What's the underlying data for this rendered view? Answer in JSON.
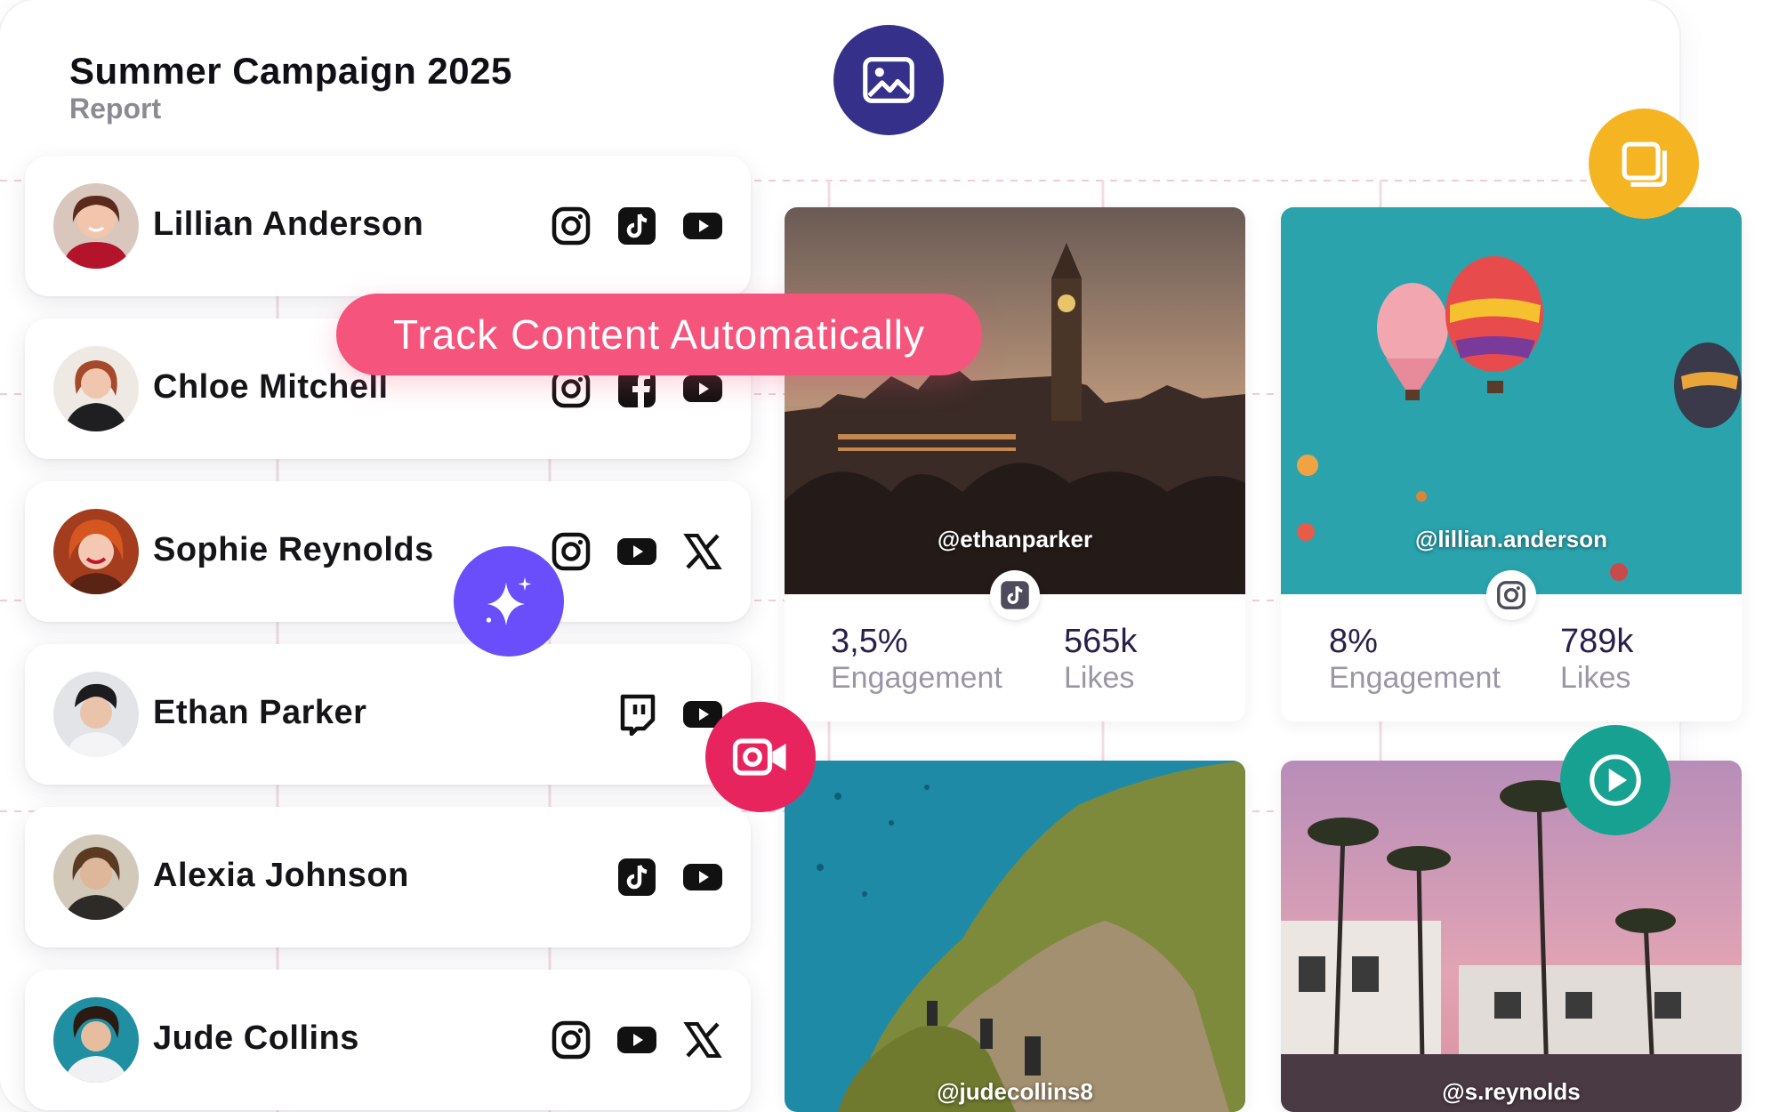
{
  "campaign": {
    "title": "Summer Campaign 2025",
    "subtitle": "Report"
  },
  "tagline": "Track Content Automatically",
  "creators": [
    {
      "name": "Lillian Anderson",
      "platforms": [
        "instagram-icon",
        "tiktok-icon",
        "youtube-icon"
      ]
    },
    {
      "name": "Chloe Mitchell",
      "platforms": [
        "instagram-icon",
        "facebook-icon",
        "youtube-icon"
      ]
    },
    {
      "name": "Sophie Reynolds",
      "platforms": [
        "instagram-icon",
        "youtube-icon",
        "x-icon"
      ]
    },
    {
      "name": "Ethan Parker",
      "platforms": [
        "twitch-icon",
        "youtube-icon"
      ]
    },
    {
      "name": "Alexia Johnson",
      "platforms": [
        "tiktok-icon",
        "youtube-icon"
      ]
    },
    {
      "name": "Jude Collins",
      "platforms": [
        "instagram-icon",
        "youtube-icon",
        "x-icon"
      ]
    }
  ],
  "posts": [
    {
      "handle": "@ethanparker",
      "platform": "tiktok-icon",
      "engagement_value": "3,5%",
      "engagement_label": "Engagement",
      "likes_value": "565k",
      "likes_label": "Likes"
    },
    {
      "handle": "@lillian.anderson",
      "platform": "instagram-icon",
      "engagement_value": "8%",
      "engagement_label": "Engagement",
      "likes_value": "789k",
      "likes_label": "Likes"
    },
    {
      "handle": "@judecollins8"
    },
    {
      "handle": "@s.reynolds"
    }
  ],
  "floating_buttons": [
    "image-icon",
    "copy-icon",
    "sparkle-icon",
    "video-camera-icon",
    "play-icon"
  ],
  "colors": {
    "accent_pink": "#f5557c",
    "indigo": "#35308a",
    "purple": "#6a4dfb",
    "amber": "#f5b523",
    "teal": "#16a191",
    "magenta": "#e8245f"
  }
}
